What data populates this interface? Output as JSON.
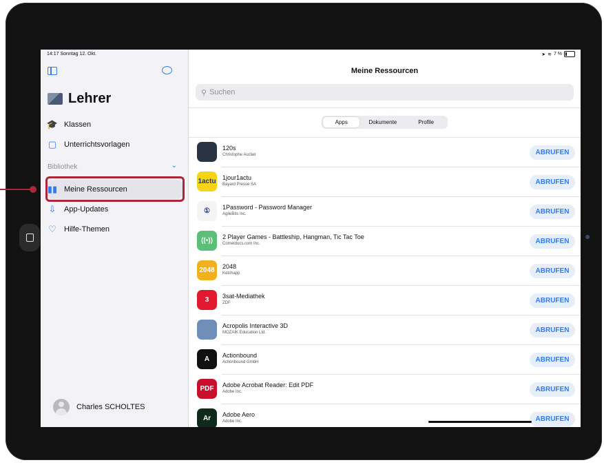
{
  "status": {
    "time_date": "14:17  Sonntag 12. Okt.",
    "right": "7 %"
  },
  "sidebar": {
    "title": "Lehrer",
    "items": [
      {
        "label": "Klassen",
        "icon": "graduation-cap-icon"
      },
      {
        "label": "Unterrichtsvorlagen",
        "icon": "square-stack-icon"
      }
    ],
    "section": "Bibliothek",
    "library_items": [
      {
        "label": "Meine Ressourcen",
        "icon": "books-icon",
        "selected": true
      },
      {
        "label": "App-Updates",
        "icon": "tray-download-icon"
      },
      {
        "label": "Hilfe-Themen",
        "icon": "lightbulb-icon"
      }
    ],
    "user": "Charles SCHOLTES"
  },
  "main": {
    "title": "Meine Ressourcen",
    "search_placeholder": "Suchen",
    "segments": [
      "Apps",
      "Dokumente",
      "Profile"
    ],
    "button_label": "ABRUFEN",
    "apps": [
      {
        "name": "120s",
        "developer": "Christophe Auclair",
        "icon_color": "#2a3342",
        "icon_text": ""
      },
      {
        "name": "1jour1actu",
        "developer": "Bayard Presse SA",
        "icon_color": "#f7d417",
        "icon_text": "1actu"
      },
      {
        "name": "1Password - Password Manager",
        "developer": "AgileBits Inc.",
        "icon_color": "#f4f4f4",
        "icon_text": "①"
      },
      {
        "name": "2 Player Games - Battleship, Hangman, Tic Tac Toe",
        "developer": "Cometdocs.com Inc.",
        "icon_color": "#5bbf7a",
        "icon_text": "((•))"
      },
      {
        "name": "2048",
        "developer": "Ketchapp",
        "icon_color": "#f2b01e",
        "icon_text": "2048"
      },
      {
        "name": "3sat-Mediathek",
        "developer": "ZDF",
        "icon_color": "#e1192e",
        "icon_text": "3"
      },
      {
        "name": "Acropolis Interactive 3D",
        "developer": "MOZAIK Education Ltd.",
        "icon_color": "#6f8fb8",
        "icon_text": ""
      },
      {
        "name": "Actionbound",
        "developer": "Actionbound GmbH",
        "icon_color": "#111111",
        "icon_text": "A"
      },
      {
        "name": "Adobe Acrobat Reader: Edit PDF",
        "developer": "Adobe Inc.",
        "icon_color": "#c8102e",
        "icon_text": "PDF"
      },
      {
        "name": "Adobe Aero",
        "developer": "Adobe Inc.",
        "icon_color": "#0f2a1a",
        "icon_text": "Ar"
      }
    ]
  },
  "colors": {
    "accent": "#2f7cf6",
    "highlight": "#a8283a"
  }
}
